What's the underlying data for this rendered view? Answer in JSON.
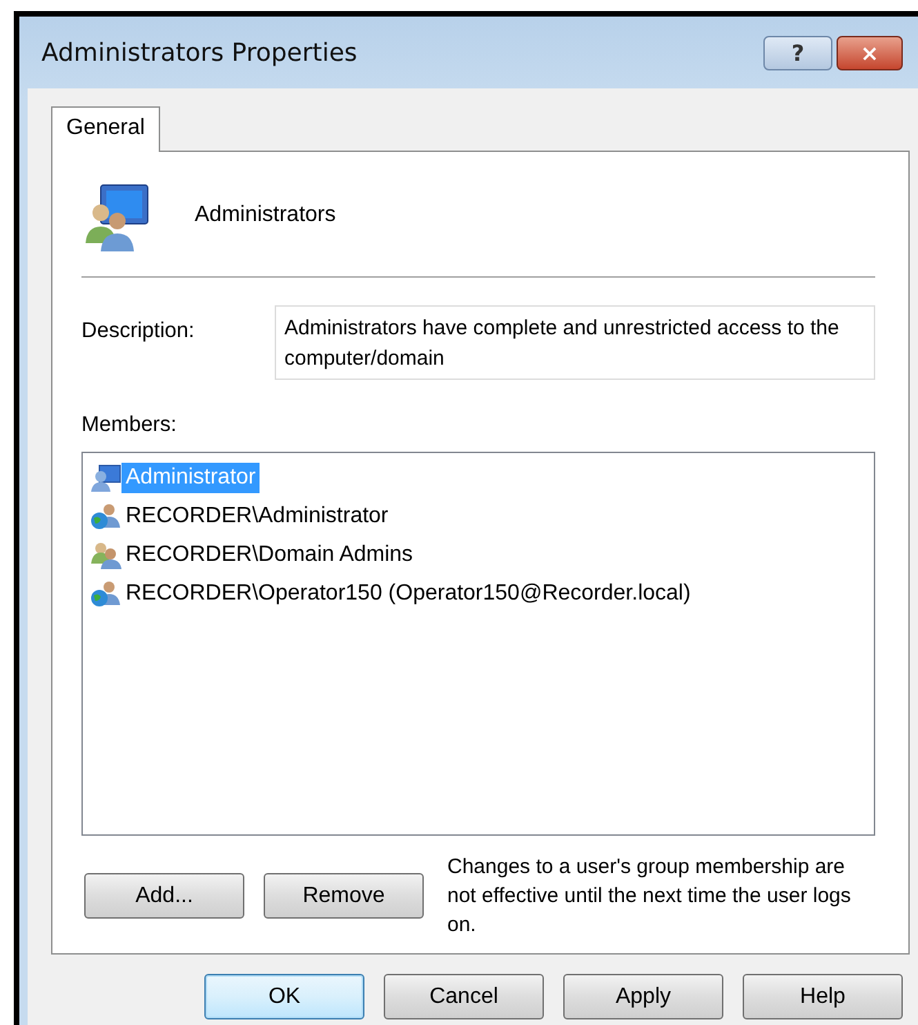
{
  "window": {
    "title": "Administrators Properties",
    "help_button": "?",
    "close_button": "×"
  },
  "tabs": [
    {
      "label": "General",
      "selected": true
    }
  ],
  "group": {
    "name": "Administrators"
  },
  "description": {
    "label": "Description:",
    "value": "Administrators have complete and unrestricted access to the computer/domain"
  },
  "members": {
    "label": "Members:",
    "items": [
      {
        "name": "Administrator",
        "kind": "local-user",
        "selected": true
      },
      {
        "name": "RECORDER\\Administrator",
        "kind": "domain-user",
        "selected": false
      },
      {
        "name": "RECORDER\\Domain Admins",
        "kind": "group",
        "selected": false
      },
      {
        "name": "RECORDER\\Operator150 (Operator150@Recorder.local)",
        "kind": "domain-user",
        "selected": false
      }
    ]
  },
  "member_buttons": [
    "Add...",
    "Remove"
  ],
  "note": "Changes to a user's group membership are not effective until the next time the user logs on.",
  "buttons": [
    {
      "label": "OK",
      "default": true
    },
    {
      "label": "Cancel",
      "default": false
    },
    {
      "label": "Apply",
      "default": false
    },
    {
      "label": "Help",
      "default": false
    }
  ]
}
